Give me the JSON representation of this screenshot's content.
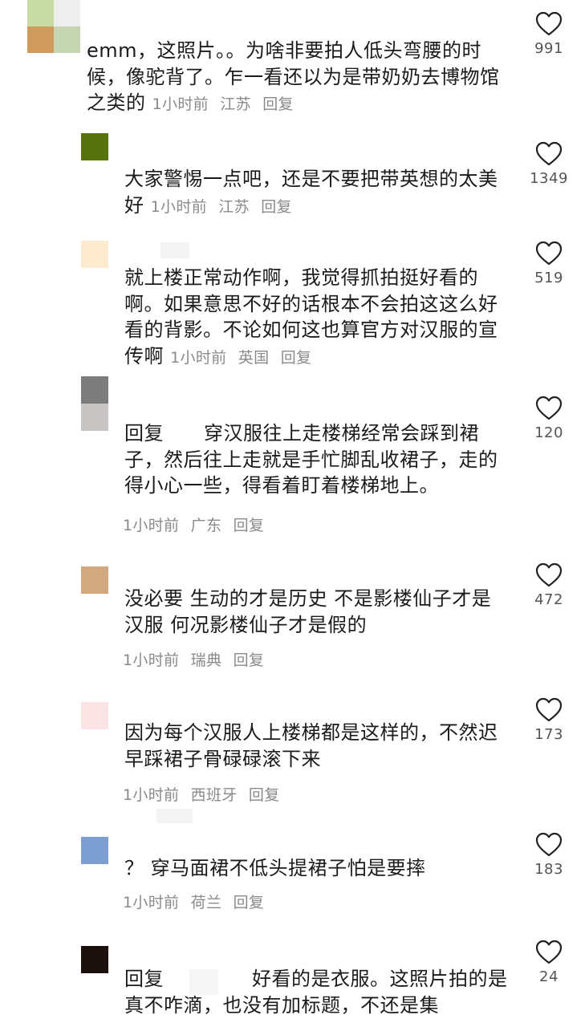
{
  "comments": [
    {
      "avatar_colors": [
        "#c9dba4",
        "#eeeeee",
        "#cf9a5e",
        "#c6d6b0"
      ],
      "text": "emm，这照片。。为啥非要拍人低头弯腰的时候，像驼背了。乍一看还以为是带奶奶去博物馆之类的",
      "time": "1小时前",
      "location": "江苏",
      "reply": "回复",
      "likes": "991"
    },
    {
      "avatar_color": "#55720f",
      "text": "大家警惕一点吧，还是不要把带英想的太美好",
      "time": "1小时前",
      "location": "江苏",
      "reply": "回复",
      "likes": "1349"
    },
    {
      "avatar_color": "#fdebd0",
      "text": "就上楼正常动作啊，我觉得抓拍挺好看的啊。如果意思不好的话根本不会拍这这么好看的背影。不论如何这也算官方对汉服的宣传啊",
      "time": "1小时前",
      "location": "英国",
      "reply": "回复",
      "likes": "519"
    },
    {
      "avatar_colors": [
        "#7c7c7c",
        "#c9c5c5"
      ],
      "prefix": "回复",
      "text": "穿汉服往上走楼梯经常会踩到裙子，然后往上走就是手忙脚乱收裙子，走的得小心一些，得看着盯着楼梯地上。",
      "time": "1小时前",
      "location": "广东",
      "reply": "回复",
      "likes": "120"
    },
    {
      "avatar_color": "#d2a97e",
      "text": "没必要 生动的才是历史 不是影楼仙子才是汉服 何况影楼仙子才是假的",
      "time": "1小时前",
      "location": "瑞典",
      "reply": "回复",
      "likes": "472"
    },
    {
      "avatar_color": "#fbe3e6",
      "text": "因为每个汉服人上楼梯都是这样的，不然迟早踩裙子骨碌碌滚下来",
      "time": "1小时前",
      "location": "西班牙",
      "reply": "回复",
      "likes": "173"
    },
    {
      "avatar_color": "#7d9ed0",
      "text": "？ 穿马面裙不低头提裙子怕是要摔",
      "time": "1小时前",
      "location": "荷兰",
      "reply": "回复",
      "likes": "183"
    },
    {
      "avatar_color": "#1c100d",
      "prefix": "回复",
      "text": "好看的是衣服。这照片拍的是真不咋滴，也没有加标题，不还是集",
      "likes": "24"
    }
  ],
  "icons": {
    "like": "heart-outline-icon"
  }
}
